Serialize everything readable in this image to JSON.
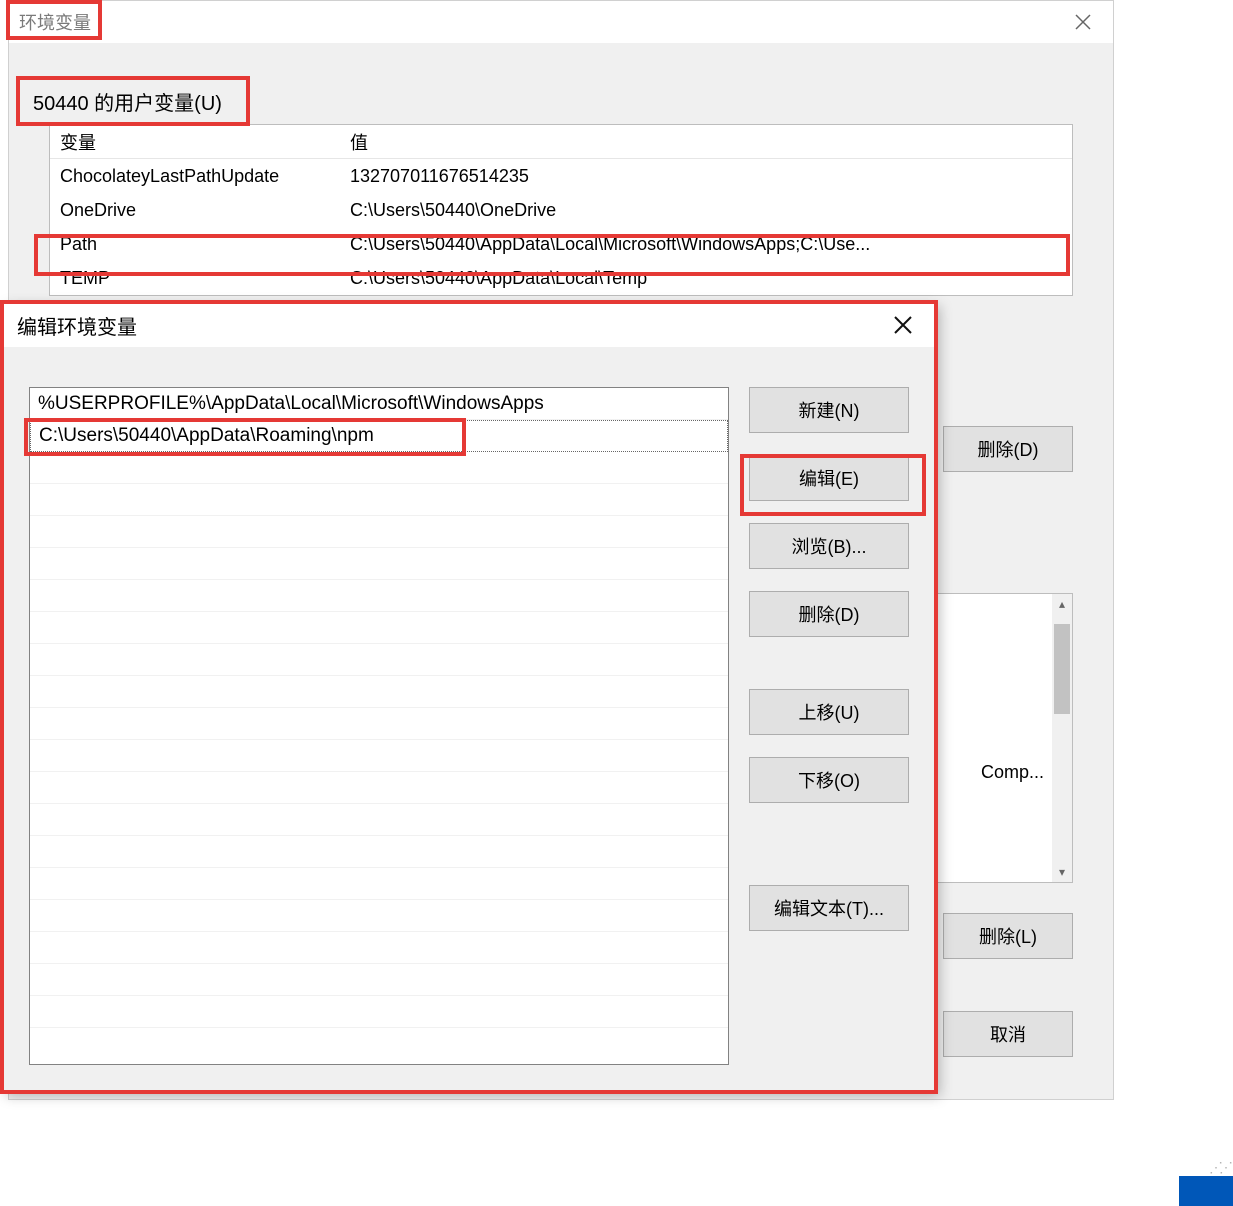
{
  "env_dialog": {
    "title": "环境变量",
    "user_section_label": "50440 的用户变量(U)",
    "col_variable": "变量",
    "col_value": "值",
    "user_vars": [
      {
        "name": "ChocolateyLastPathUpdate",
        "value": "132707011676514235"
      },
      {
        "name": "OneDrive",
        "value": "C:\\Users\\50440\\OneDrive"
      },
      {
        "name": "Path",
        "value": "C:\\Users\\50440\\AppData\\Local\\Microsoft\\WindowsApps;C:\\Use..."
      },
      {
        "name": "TEMP",
        "value": "C:\\Users\\50440\\AppData\\Local\\Temp"
      }
    ],
    "btn_delete_user": "删除(D)",
    "sys_fragment_text": "Comp...",
    "btn_delete_sys": "删除(L)",
    "btn_cancel": "取消"
  },
  "edit_dialog": {
    "title": "编辑环境变量",
    "paths": [
      "%USERPROFILE%\\AppData\\Local\\Microsoft\\WindowsApps",
      "C:\\Users\\50440\\AppData\\Roaming\\npm"
    ],
    "btn_new": "新建(N)",
    "btn_edit": "编辑(E)",
    "btn_browse": "浏览(B)...",
    "btn_delete": "删除(D)",
    "btn_up": "上移(U)",
    "btn_down": "下移(O)",
    "btn_edit_text": "编辑文本(T)..."
  }
}
